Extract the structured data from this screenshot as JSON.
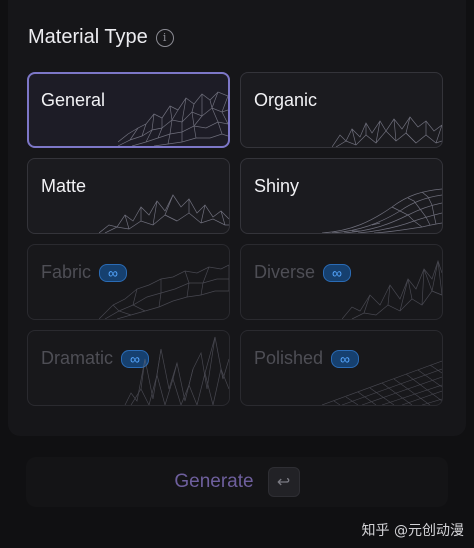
{
  "section": {
    "title": "Material Type",
    "info_icon": "info-icon"
  },
  "materials": [
    {
      "label": "General",
      "selected": true,
      "locked": false
    },
    {
      "label": "Organic",
      "selected": false,
      "locked": false
    },
    {
      "label": "Matte",
      "selected": false,
      "locked": false
    },
    {
      "label": "Shiny",
      "selected": false,
      "locked": false
    },
    {
      "label": "Fabric",
      "selected": false,
      "locked": true,
      "badge": "∞"
    },
    {
      "label": "Diverse",
      "selected": false,
      "locked": true,
      "badge": "∞"
    },
    {
      "label": "Dramatic",
      "selected": false,
      "locked": true,
      "badge": "∞"
    },
    {
      "label": "Polished",
      "selected": false,
      "locked": true,
      "badge": "∞"
    }
  ],
  "generate": {
    "label": "Generate",
    "icon": "enter-icon",
    "key_glyph": "↩"
  },
  "watermark": "知乎 @元创动漫",
  "colors": {
    "selected_border": "#7d77c8",
    "badge_text": "#55a6ff",
    "generate_text": "#6e5f9d"
  }
}
